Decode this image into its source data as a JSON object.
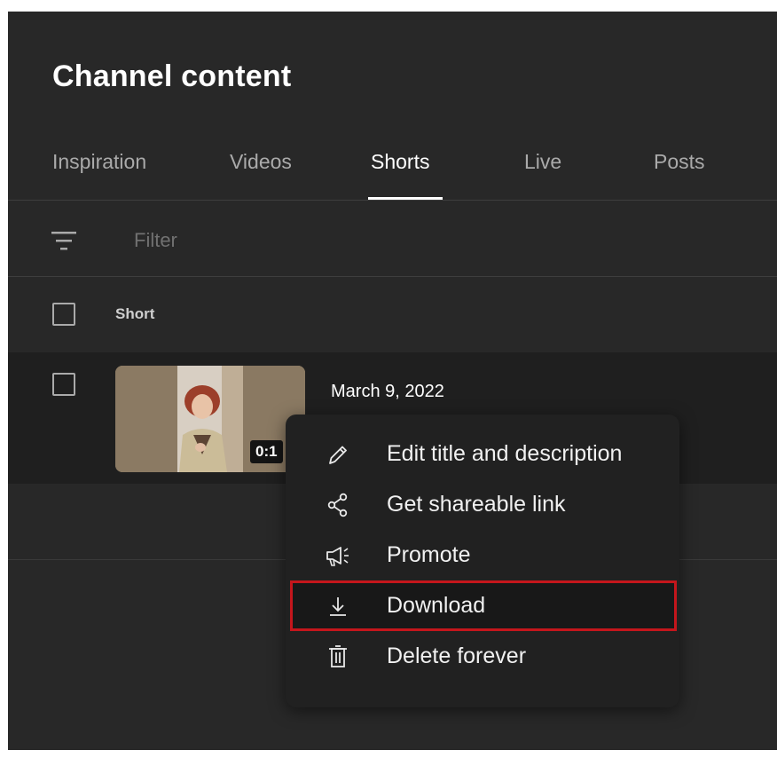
{
  "header": {
    "title": "Channel content"
  },
  "tabs": [
    {
      "label": "Inspiration",
      "active": false
    },
    {
      "label": "Videos",
      "active": false
    },
    {
      "label": "Shorts",
      "active": true
    },
    {
      "label": "Live",
      "active": false
    },
    {
      "label": "Posts",
      "active": false
    }
  ],
  "filter": {
    "placeholder": "Filter",
    "icon": "filter-icon"
  },
  "table": {
    "column_header": "Short",
    "rows": [
      {
        "date": "March 9, 2022",
        "duration": "0:1"
      }
    ]
  },
  "context_menu": {
    "items": [
      {
        "label": "Edit title and description",
        "icon": "pencil-icon"
      },
      {
        "label": "Get shareable link",
        "icon": "share-icon"
      },
      {
        "label": "Promote",
        "icon": "megaphone-icon"
      },
      {
        "label": "Download",
        "icon": "download-icon",
        "highlighted": true
      },
      {
        "label": "Delete forever",
        "icon": "trash-icon"
      }
    ]
  },
  "colors": {
    "background": "#282828",
    "row_background": "#1f1f1f",
    "menu_background": "#212121",
    "highlight_border": "#c4161c"
  }
}
